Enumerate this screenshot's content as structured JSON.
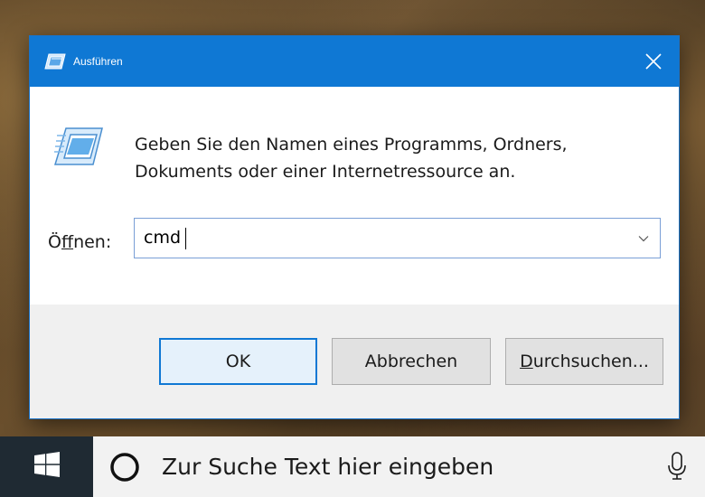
{
  "dialog": {
    "title": "Ausführen",
    "title_icon": "run-icon",
    "close_icon": "close-icon",
    "prompt_icon": "run-icon",
    "prompt_line1": "Geben Sie den Namen eines Programms, Ordners,",
    "prompt_line2": "Dokuments oder einer Internetressource an.",
    "open_label_pre": "Ö",
    "open_label_access": "f",
    "open_label_post": "fnen:",
    "open_value": "cmd",
    "dropdown_icon": "chevron-down-icon",
    "buttons": {
      "ok": "OK",
      "cancel": "Abbrechen",
      "browse_access": "D",
      "browse_rest": "urchsuchen..."
    }
  },
  "taskbar": {
    "start_icon": "windows-logo-icon",
    "search_placeholder": "Zur Suche Text hier eingeben",
    "cortana_icon": "cortana-icon",
    "mic_icon": "microphone-icon"
  },
  "colors": {
    "titlebar": "#0f78d4",
    "default_button_border": "#1078d4",
    "taskbar": "#1f2a33"
  }
}
